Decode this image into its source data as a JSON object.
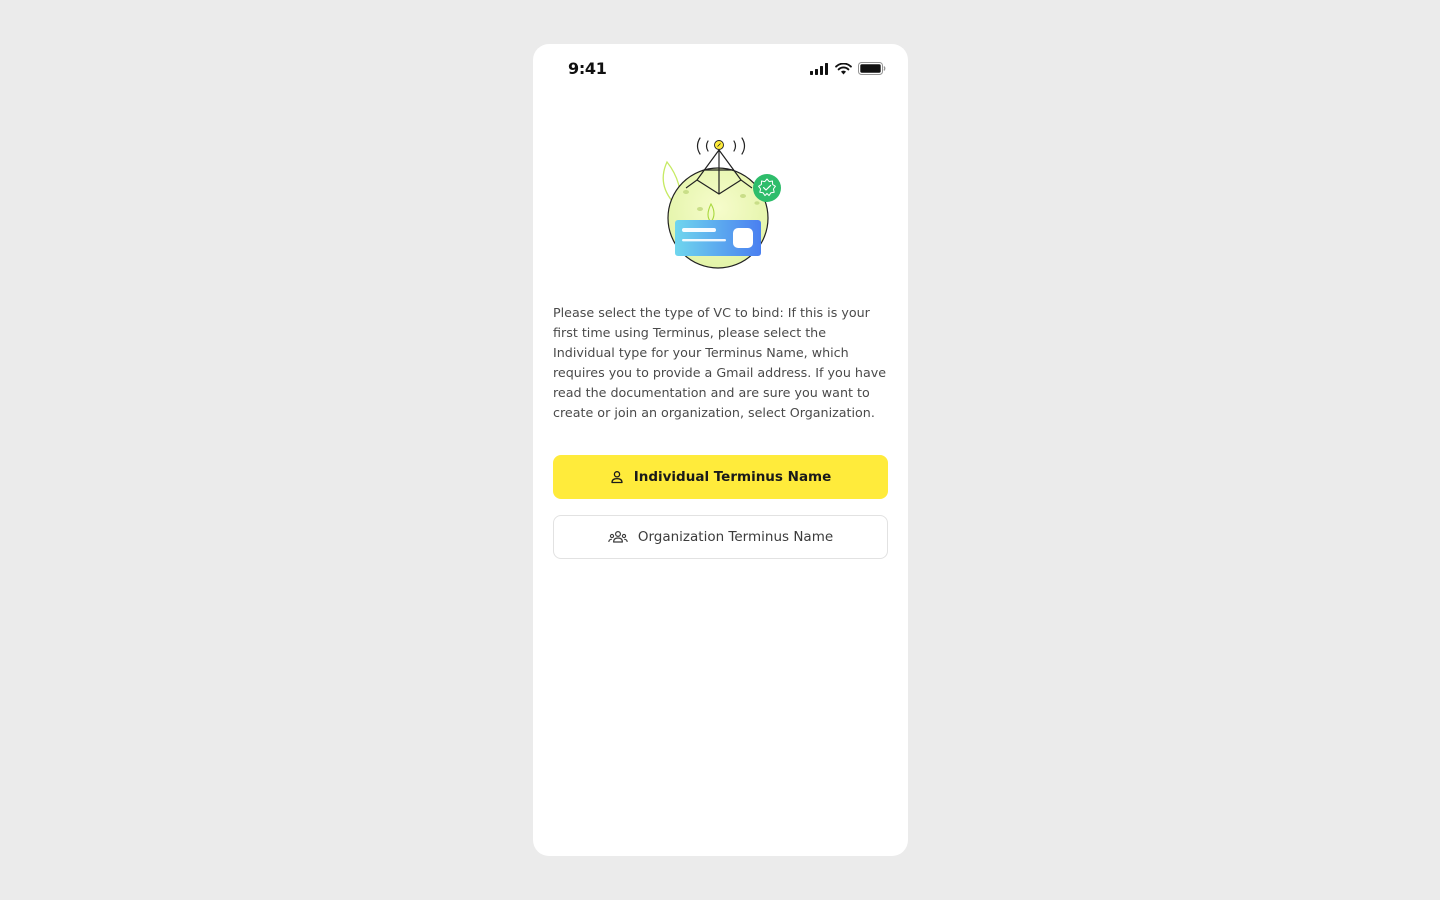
{
  "status_bar": {
    "time": "9:41",
    "icons": [
      "cellular-signal-icon",
      "wifi-icon",
      "battery-icon"
    ]
  },
  "illustration": {
    "name": "vc-card-globe-illustration",
    "colors": {
      "globe": "#eaf7b4",
      "card_start": "#6fd6ee",
      "card_end": "#4a7ff0",
      "badge": "#2ebd6b",
      "accent": "#ffeb3b"
    }
  },
  "content": {
    "description": "Please select the type of VC to bind: If this is your first time using Terminus, please select the Individual type for your Terminus Name, which requires you to provide a Gmail address. If you have read the documentation and are sure you want to create or join an organization, select Organization."
  },
  "actions": {
    "individual": {
      "label": "Individual Terminus Name",
      "icon": "person-icon",
      "color": "#ffeb3b"
    },
    "organization": {
      "label": "Organization Terminus Name",
      "icon": "group-icon"
    }
  }
}
